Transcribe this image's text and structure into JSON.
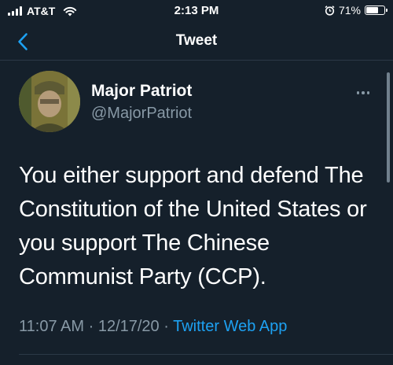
{
  "status_bar": {
    "carrier": "AT&T",
    "time": "2:13 PM",
    "battery_percent": "71%",
    "battery_level": 0.71
  },
  "nav": {
    "title": "Tweet"
  },
  "tweet": {
    "author_name": "Major Patriot",
    "author_handle": "@MajorPatriot",
    "text": "You either support and defend The Constitution of the United States or you support The Chinese Communist Party (CCP).",
    "time": "11:07 AM",
    "date": "12/17/20",
    "separator": "·",
    "source": "Twitter Web App"
  },
  "colors": {
    "background": "#15202b",
    "secondary_text": "#8899a6",
    "accent": "#1da1f2"
  },
  "icons": {
    "back": "chevron-left-icon",
    "more": "more-horizontal-icon",
    "wifi": "wifi-icon",
    "alarm": "alarm-icon",
    "battery": "battery-icon",
    "signal": "cellular-signal-icon"
  }
}
